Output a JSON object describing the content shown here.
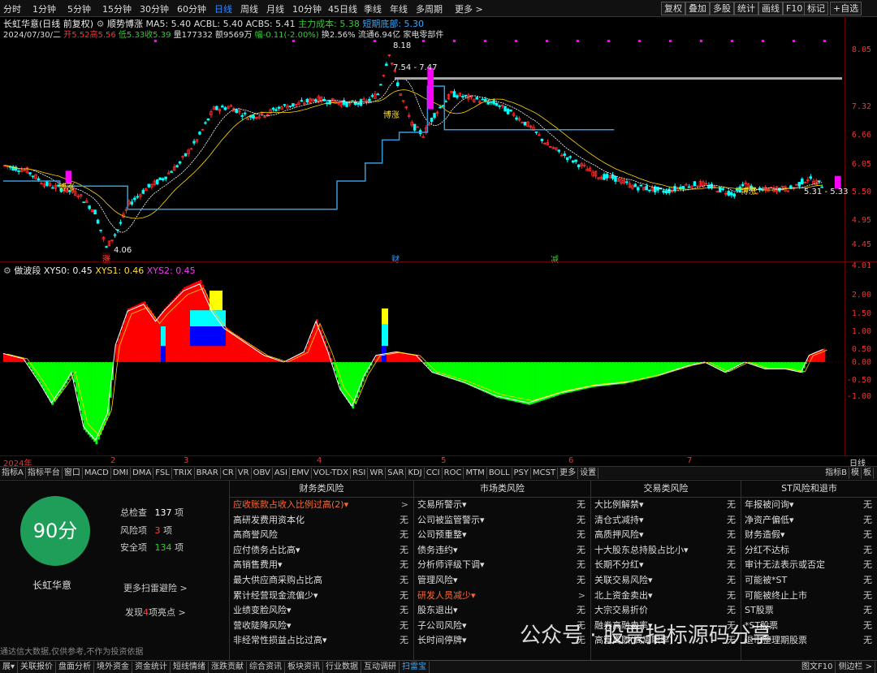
{
  "period_tabs": [
    "分时",
    "1分钟",
    "5分钟",
    "15分钟",
    "30分钟",
    "60分钟",
    "日线",
    "周线",
    "月线",
    "10分钟",
    "45日线",
    "季线",
    "年线",
    "多周期",
    "更多 >"
  ],
  "active_period": "日线",
  "toolbar_right": [
    "复权",
    "叠加",
    "多股",
    "统计",
    "画线",
    "F10",
    "标记",
    "+自选"
  ],
  "stock": {
    "title": "长虹华意(日线 前复权)",
    "indicator_name": "顺势博涨",
    "ma5": "MA5: 5.40",
    "acbl": "ACBL: 5.40",
    "acbs": "ACBS: 5.41",
    "cost_label": "主力成本: 5.38",
    "bottom_label": "短期底部: 5.30"
  },
  "quote": {
    "date": "2024/07/30/二",
    "open": "开5.52",
    "high": "高5.56",
    "low": "低5.33",
    "close": "收5.39",
    "volume": "量177332",
    "amount": "额9569万",
    "change": "幅-0.11(-2.00%)",
    "turnover": "换2.56%",
    "float": "流通6.94亿",
    "sector": "家电零部件"
  },
  "price_axis": [
    "8.05",
    "7.32",
    "6.66",
    "6.05",
    "5.50",
    "4.95",
    "4.45",
    "4.01"
  ],
  "annotations": {
    "peak": "8.18",
    "range": "7.54 - 7.47",
    "low": "4.06",
    "last": "5.31 - 5.33",
    "zhang": "涨",
    "cai": "财",
    "jian": "减",
    "bozhang": "博涨"
  },
  "lower": {
    "title": "做波段",
    "xys0": "XYS0: 0.45",
    "xys1": "XYS1: 0.46",
    "xys2": "XYS2: 0.45",
    "axis": [
      "2.00",
      "1.50",
      "1.00",
      "0.50",
      "0.00",
      "-0.50",
      "-1.00"
    ]
  },
  "date_axis": {
    "year": "2024年",
    "months": [
      "2",
      "3",
      "4",
      "5",
      "6",
      "7"
    ],
    "right": "日线"
  },
  "indicator_tabs": [
    "指标A",
    "指标平台",
    "窗口",
    "MACD",
    "DMI",
    "DMA",
    "FSL",
    "TRIX",
    "BRAR",
    "CR",
    "VR",
    "OBV",
    "ASI",
    "EMV",
    "VOL-TDX",
    "RSI",
    "WR",
    "SAR",
    "KDJ",
    "CCI",
    "ROC",
    "MTM",
    "BOLL",
    "PSY",
    "MCST",
    "更多",
    "设置"
  ],
  "indicator_right": [
    "指标B",
    "模",
    "板"
  ],
  "scan": {
    "score": "90分",
    "stock_name": "长虹华意",
    "total_label": "总检查",
    "total_val": "137",
    "risk_label": "风险项",
    "risk_val": "3",
    "safe_label": "安全项",
    "safe_val": "134",
    "unit": "项",
    "more_scan": "更多扫雷避险 >",
    "highlight_prefix": "发现",
    "highlight_count": "4",
    "highlight_suffix": "项亮点 >",
    "disclaimer": "通达信大数据,仅供参考,不作为投资依据"
  },
  "risk_columns": [
    {
      "title": "财务类风险",
      "rows": [
        {
          "label": "应收账款占收入比例过高(2)▾",
          "val": ">",
          "red": true
        },
        {
          "label": "高研发费用资本化",
          "val": "无"
        },
        {
          "label": "高商誉风险",
          "val": "无"
        },
        {
          "label": "应付债务占比高▾",
          "val": "无"
        },
        {
          "label": "高销售费用▾",
          "val": "无"
        },
        {
          "label": "最大供应商采购占比高",
          "val": "无"
        },
        {
          "label": "累计经营现金流偏少▾",
          "val": "无"
        },
        {
          "label": "业绩变脸风险▾",
          "val": "无"
        },
        {
          "label": "营收陡降风险▾",
          "val": "无"
        },
        {
          "label": "非经常性损益占比过高▾",
          "val": "无"
        }
      ]
    },
    {
      "title": "市场类风险",
      "rows": [
        {
          "label": "交易所警示▾",
          "val": "无"
        },
        {
          "label": "公司被监管警示▾",
          "val": "无"
        },
        {
          "label": "公司预重整▾",
          "val": "无"
        },
        {
          "label": "债务违约▾",
          "val": "无"
        },
        {
          "label": "分析师评级下调▾",
          "val": "无"
        },
        {
          "label": "管理风险▾",
          "val": "无"
        },
        {
          "label": "研发人员减少▾",
          "val": ">",
          "red": true
        },
        {
          "label": "股东退出▾",
          "val": "无"
        },
        {
          "label": "子公司风险▾",
          "val": "无"
        },
        {
          "label": "长时间停牌▾",
          "val": "无"
        }
      ]
    },
    {
      "title": "交易类风险",
      "rows": [
        {
          "label": "大比例解禁▾",
          "val": "无"
        },
        {
          "label": "清仓式减持▾",
          "val": "无"
        },
        {
          "label": "高质押风险▾",
          "val": "无"
        },
        {
          "label": "十大股东总持股占比小▾",
          "val": "无"
        },
        {
          "label": "长期不分红▾",
          "val": "无"
        },
        {
          "label": "关联交易风险▾",
          "val": "无"
        },
        {
          "label": "北上资金卖出▾",
          "val": "无"
        },
        {
          "label": "大宗交易折价",
          "val": "无"
        },
        {
          "label": "融券高融卖率▾",
          "val": "无"
        },
        {
          "label": "高管离职(高离职率)",
          "val": "无"
        }
      ]
    },
    {
      "title": "ST风险和退市",
      "rows": [
        {
          "label": "年报被问询▾",
          "val": "无"
        },
        {
          "label": "净资产偏低▾",
          "val": "无"
        },
        {
          "label": "财务造假▾",
          "val": "无"
        },
        {
          "label": "分红不达标",
          "val": "无"
        },
        {
          "label": "审计无法表示或否定",
          "val": "无"
        },
        {
          "label": "可能被*ST",
          "val": "无"
        },
        {
          "label": "可能被终止上市",
          "val": "无"
        },
        {
          "label": "ST股票",
          "val": "无"
        },
        {
          "label": "*ST股票",
          "val": "无"
        },
        {
          "label": "退市整理期股票",
          "val": "无"
        }
      ]
    }
  ],
  "watermark": "公众号 · 股票指标源码分享",
  "taskbar": [
    "展▾",
    "关联报价",
    "盘面分析",
    "境外资金",
    "资金统计",
    "短线情绪",
    "涨跌贡献",
    "综合资讯",
    "板块资讯",
    "行业数据",
    "互动调研",
    "扫雷宝"
  ],
  "taskbar_right": [
    "图文F10",
    "侧边栏 >"
  ],
  "colors": {
    "up": "#ff2a2a",
    "down": "#00ffff",
    "bar_up": "#ff0000",
    "bar_down": "#00ff00",
    "accent": "#3a8eff",
    "score_bg": "#1f9e5a"
  }
}
